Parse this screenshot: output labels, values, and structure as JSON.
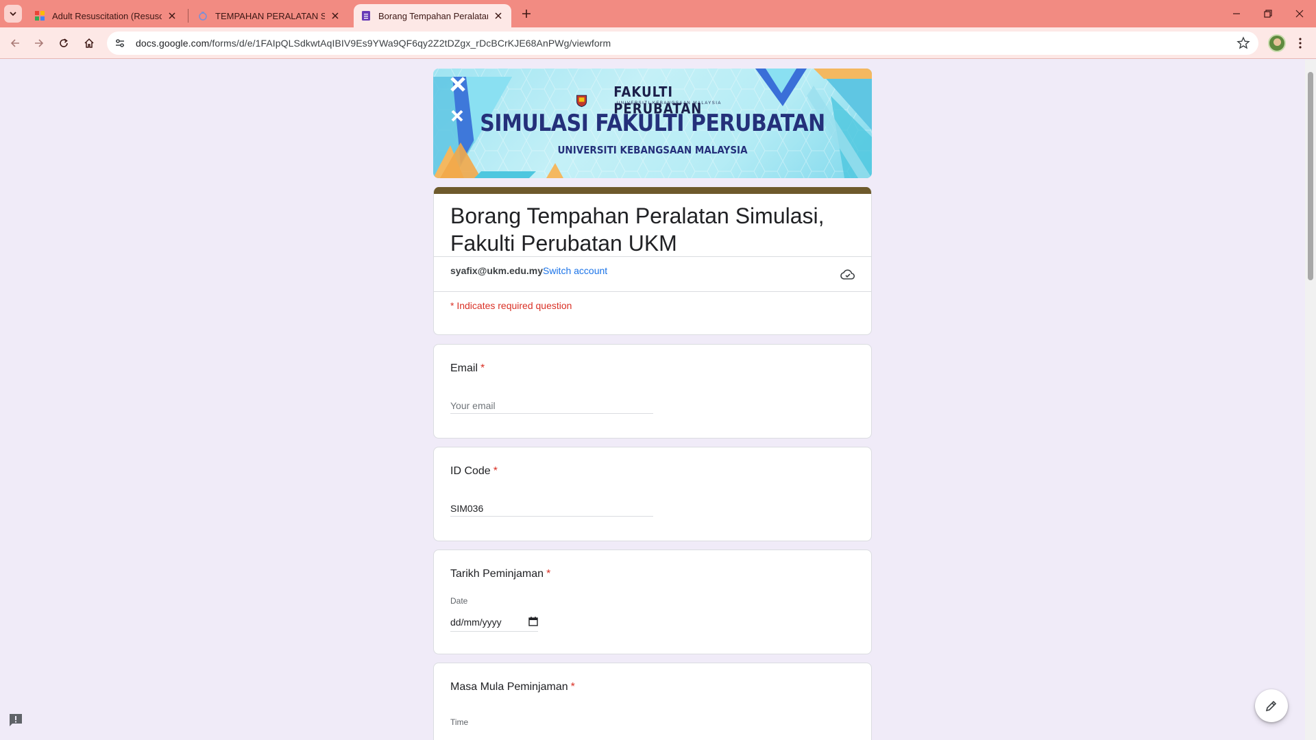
{
  "browser": {
    "tabs": [
      {
        "title": "Adult Resuscitation (Resusci Anne)",
        "active": false
      },
      {
        "title": "TEMPAHAN PERALATAN SIMULASI",
        "active": false
      },
      {
        "title": "Borang Tempahan Peralatan Simulasi",
        "active": true
      }
    ],
    "url_host": "docs.google.com",
    "url_path": "/forms/d/e/1FAIpQLSdkwtAqIBIV9Es9YWa9QF6qy2Z2tDZgx_rDcBCrKJE68AnPWg/viewform"
  },
  "banner": {
    "faculty": "FAKULTI PERUBATAN",
    "faculty_sub": "UNIVERSITI KEBANGSAAN MALAYSIA",
    "title": "SIMULASI FAKULTI PERUBATAN",
    "subtitle": "UNIVERSITI KEBANGSAAN MALAYSIA"
  },
  "form": {
    "title": "Borang Tempahan Peralatan Simulasi, Fakulti Perubatan UKM",
    "account_email": "syafix@ukm.edu.my",
    "switch_account": "Switch account",
    "required_note": "* Indicates required question",
    "questions": {
      "email": {
        "label": "Email",
        "required_mark": "*",
        "placeholder": "Your email",
        "value": ""
      },
      "id_code": {
        "label": "ID Code",
        "required_mark": "*",
        "value": "SIM036"
      },
      "tarikh": {
        "label": "Tarikh Peminjaman",
        "required_mark": "*",
        "sub_label": "Date",
        "placeholder": "dd/mm/yyyy"
      },
      "masa_mula": {
        "label": "Masa Mula Peminjaman",
        "required_mark": "*",
        "sub_label": "Time"
      }
    }
  },
  "colors": {
    "tab_strip": "#f28b82",
    "header_accent": "#6e5a2c",
    "required_red": "#d93025",
    "link_blue": "#1a73e8",
    "page_bg": "#f0ebf8"
  }
}
